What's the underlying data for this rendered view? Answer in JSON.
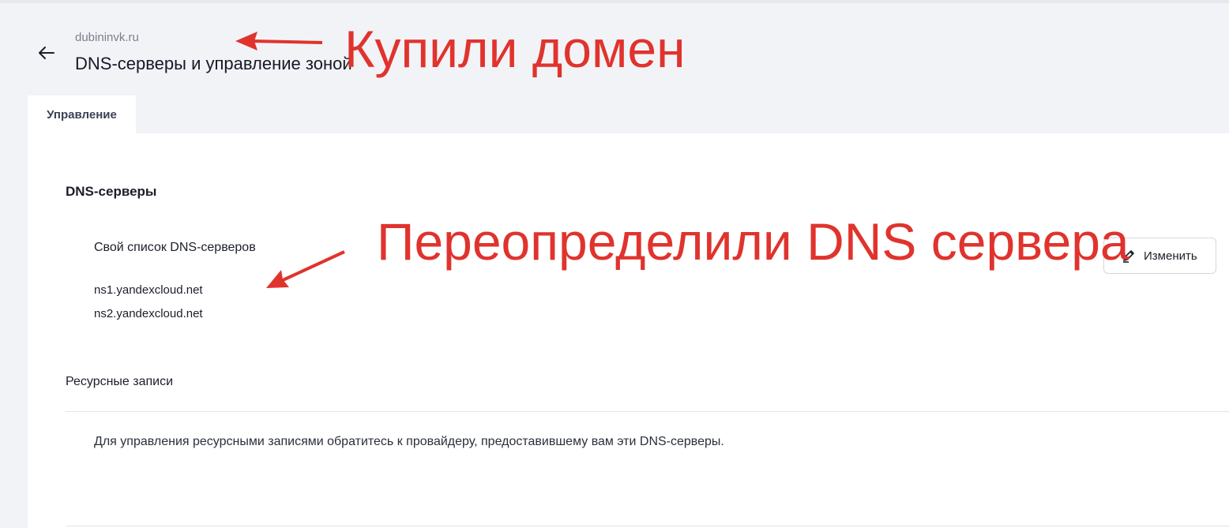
{
  "header": {
    "domain": "dubininvk.ru",
    "title": "DNS-серверы и управление зоной"
  },
  "tabs": [
    {
      "label": "Управление",
      "active": true
    }
  ],
  "dns_section": {
    "title": "DNS-серверы",
    "list_title": "Свой список DNS-серверов",
    "servers": [
      "ns1.yandexcloud.net",
      "ns2.yandexcloud.net"
    ],
    "edit_button": {
      "label": "Изменить",
      "icon": "pencil-icon"
    }
  },
  "resource_section": {
    "title": "Ресурсные записи",
    "info": "Для управления ресурсными записями обратитесь к провайдеру, предоставившему вам эти DNS-серверы."
  },
  "annotations": {
    "domain_note": "Купили домен",
    "dns_note": "Переопределили DNS сервера",
    "color": "#e0332d"
  },
  "colors": {
    "page_bg": "#f2f3f7",
    "panel_bg": "#ffffff"
  }
}
